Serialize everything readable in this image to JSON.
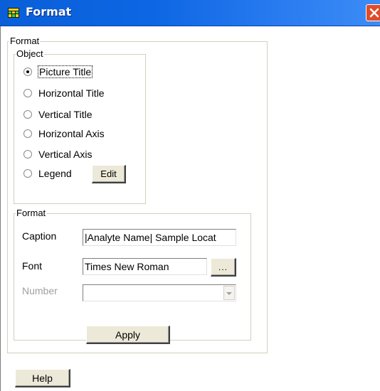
{
  "window": {
    "title": "Format"
  },
  "format_group": {
    "legend": "Format"
  },
  "object_group": {
    "legend": "Object",
    "options": [
      {
        "label": "Picture Title",
        "checked": true
      },
      {
        "label": "Horizontal Title",
        "checked": false
      },
      {
        "label": "Vertical Title",
        "checked": false
      },
      {
        "label": "Horizontal Axis",
        "checked": false
      },
      {
        "label": "Vertical Axis",
        "checked": false
      },
      {
        "label": "Legend",
        "checked": false
      }
    ],
    "edit_label": "Edit"
  },
  "inner_format": {
    "legend": "Format",
    "caption_label": "Caption",
    "caption_value": "|Analyte Name| Sample Locat",
    "font_label": "Font",
    "font_value": "Times New Roman",
    "browse_label": "...",
    "number_label": "Number",
    "number_value": ""
  },
  "apply_label": "Apply",
  "help_label": "Help"
}
